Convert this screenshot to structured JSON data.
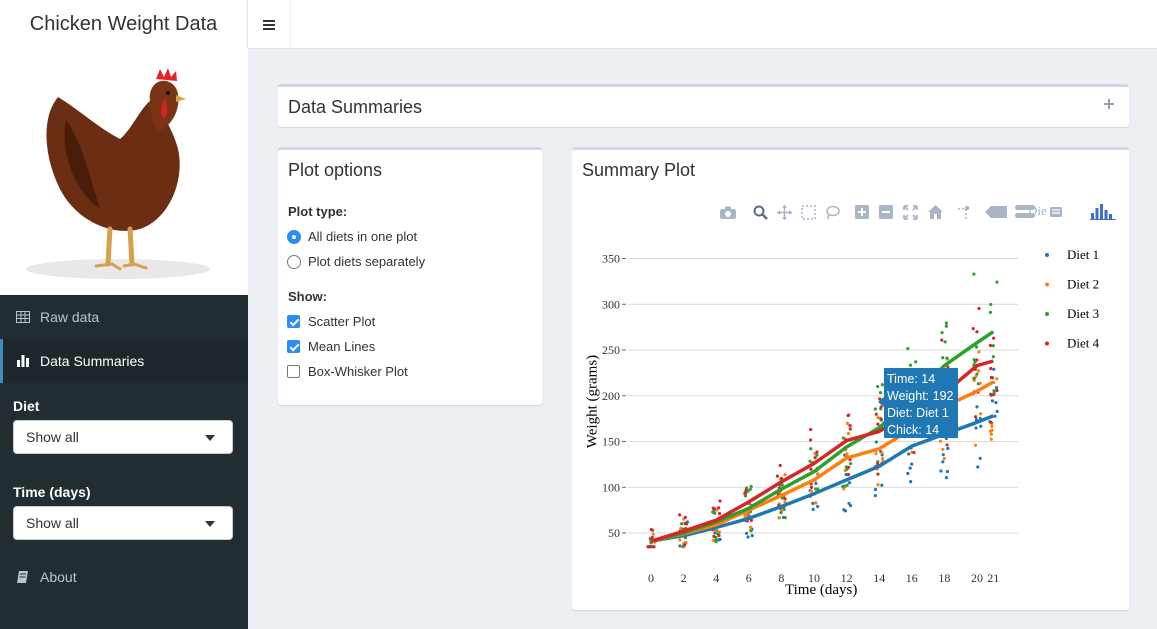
{
  "app": {
    "title": "Chicken Weight Data"
  },
  "sidebar": {
    "items": [
      {
        "label": "Raw data",
        "icon": "table-icon"
      },
      {
        "label": "Data Summaries",
        "icon": "bar-chart-icon"
      },
      {
        "label": "About",
        "icon": "book-icon"
      }
    ],
    "diet": {
      "label": "Diet",
      "value": "Show all"
    },
    "time": {
      "label": "Time (days)",
      "value": "Show all"
    }
  },
  "summaries_box": {
    "title": "Data Summaries"
  },
  "options_box": {
    "title": "Plot options",
    "plot_type_label": "Plot type:",
    "plot_types": [
      "All diets in one plot",
      "Plot diets separately"
    ],
    "show_label": "Show:",
    "show_options": [
      "Scatter Plot",
      "Mean Lines",
      "Box-Whisker Plot"
    ]
  },
  "plot_box": {
    "title": "Summary Plot"
  },
  "colors": {
    "diet1": "#1f77b4",
    "diet2": "#ff7f0e",
    "diet3": "#2ca02c",
    "diet4": "#d62728",
    "accent": "#3c8dbc",
    "sidebar": "#222d32"
  },
  "tooltip": {
    "lines": [
      "Time: 14",
      "Weight: 192",
      "Diet: Diet 1",
      "Chick: 14"
    ]
  },
  "chart_data": {
    "type": "scatter",
    "xlabel": "Time (days)",
    "ylabel": "Weight (grams)",
    "xlim": [
      -1,
      22
    ],
    "ylim": [
      25,
      375
    ],
    "x_ticks": [
      0,
      2,
      4,
      6,
      8,
      10,
      12,
      14,
      16,
      18,
      20,
      21
    ],
    "y_ticks": [
      50,
      100,
      150,
      200,
      250,
      300,
      350
    ],
    "legend": "top-right",
    "legend_title": "Die",
    "times": [
      0,
      2,
      4,
      6,
      8,
      10,
      12,
      14,
      16,
      18,
      20,
      21
    ],
    "series": [
      {
        "name": "Diet 1",
        "mean": [
          41,
          47,
          56,
          66,
          79,
          93,
          108,
          123,
          145,
          158,
          171,
          178
        ]
      },
      {
        "name": "Diet 2",
        "mean": [
          41,
          49,
          59,
          75,
          91,
          108,
          132,
          142,
          164,
          188,
          205,
          215
        ]
      },
      {
        "name": "Diet 3",
        "mean": [
          41,
          50,
          62,
          77,
          98,
          117,
          144,
          165,
          198,
          233,
          258,
          270
        ]
      },
      {
        "name": "Diet 4",
        "mean": [
          41,
          52,
          64,
          84,
          106,
          126,
          151,
          161,
          182,
          203,
          233,
          238
        ]
      }
    ]
  }
}
